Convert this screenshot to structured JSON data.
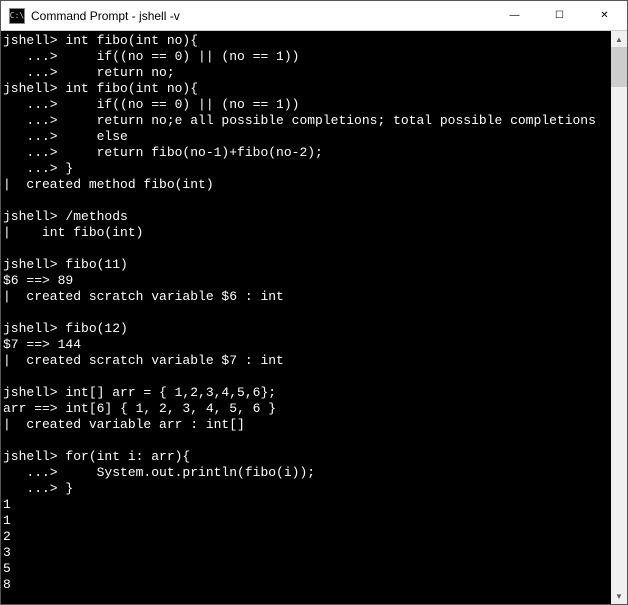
{
  "window": {
    "title": "Command Prompt - jshell  -v",
    "icon_label": "C:\\"
  },
  "controls": {
    "minimize": "—",
    "maximize": "☐",
    "close": "✕"
  },
  "terminal": {
    "lines": [
      "jshell> int fibo(int no){",
      "   ...>     if((no == 0) || (no == 1))",
      "   ...>     return no;",
      "jshell> int fibo(int no){",
      "   ...>     if((no == 0) || (no == 1))",
      "   ...>     return no;e all possible completions; total possible completions",
      "   ...>     else",
      "   ...>     return fibo(no-1)+fibo(no-2);",
      "   ...> }",
      "|  created method fibo(int)",
      "",
      "jshell> /methods",
      "|    int fibo(int)",
      "",
      "jshell> fibo(11)",
      "$6 ==> 89",
      "|  created scratch variable $6 : int",
      "",
      "jshell> fibo(12)",
      "$7 ==> 144",
      "|  created scratch variable $7 : int",
      "",
      "jshell> int[] arr = { 1,2,3,4,5,6};",
      "arr ==> int[6] { 1, 2, 3, 4, 5, 6 }",
      "|  created variable arr : int[]",
      "",
      "jshell> for(int i: arr){",
      "   ...>     System.out.println(fibo(i));",
      "   ...> }",
      "1",
      "1",
      "2",
      "3",
      "5",
      "8"
    ]
  }
}
